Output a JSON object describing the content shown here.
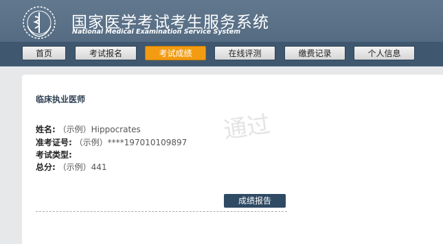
{
  "header": {
    "title_cn": "国家医学考试考生服务系统",
    "title_en": "National Medical Examination Service System",
    "logo": "medical-emblem-icon"
  },
  "nav": {
    "items": [
      {
        "label": "首页"
      },
      {
        "label": "考试报名"
      },
      {
        "label": "考试成绩",
        "active": true
      },
      {
        "label": "在线评测"
      },
      {
        "label": "缴费记录"
      },
      {
        "label": "个人信息"
      }
    ]
  },
  "result": {
    "cert_title": "临床执业医师",
    "name_label": "姓名:",
    "name_value": "（示例）Hippocrates",
    "ticket_label": "准考证号:",
    "ticket_value": "（示例）****197010109897",
    "type_label": "考试类型:",
    "type_value": "",
    "score_label": "总分:",
    "score_value": "（示例）441",
    "stamp": "通过",
    "report_button": "成绩报告"
  },
  "colors": {
    "header": "#546b82",
    "navbar": "#3f5870",
    "active_tab": "#f39c12",
    "button": "#2f4a63"
  }
}
